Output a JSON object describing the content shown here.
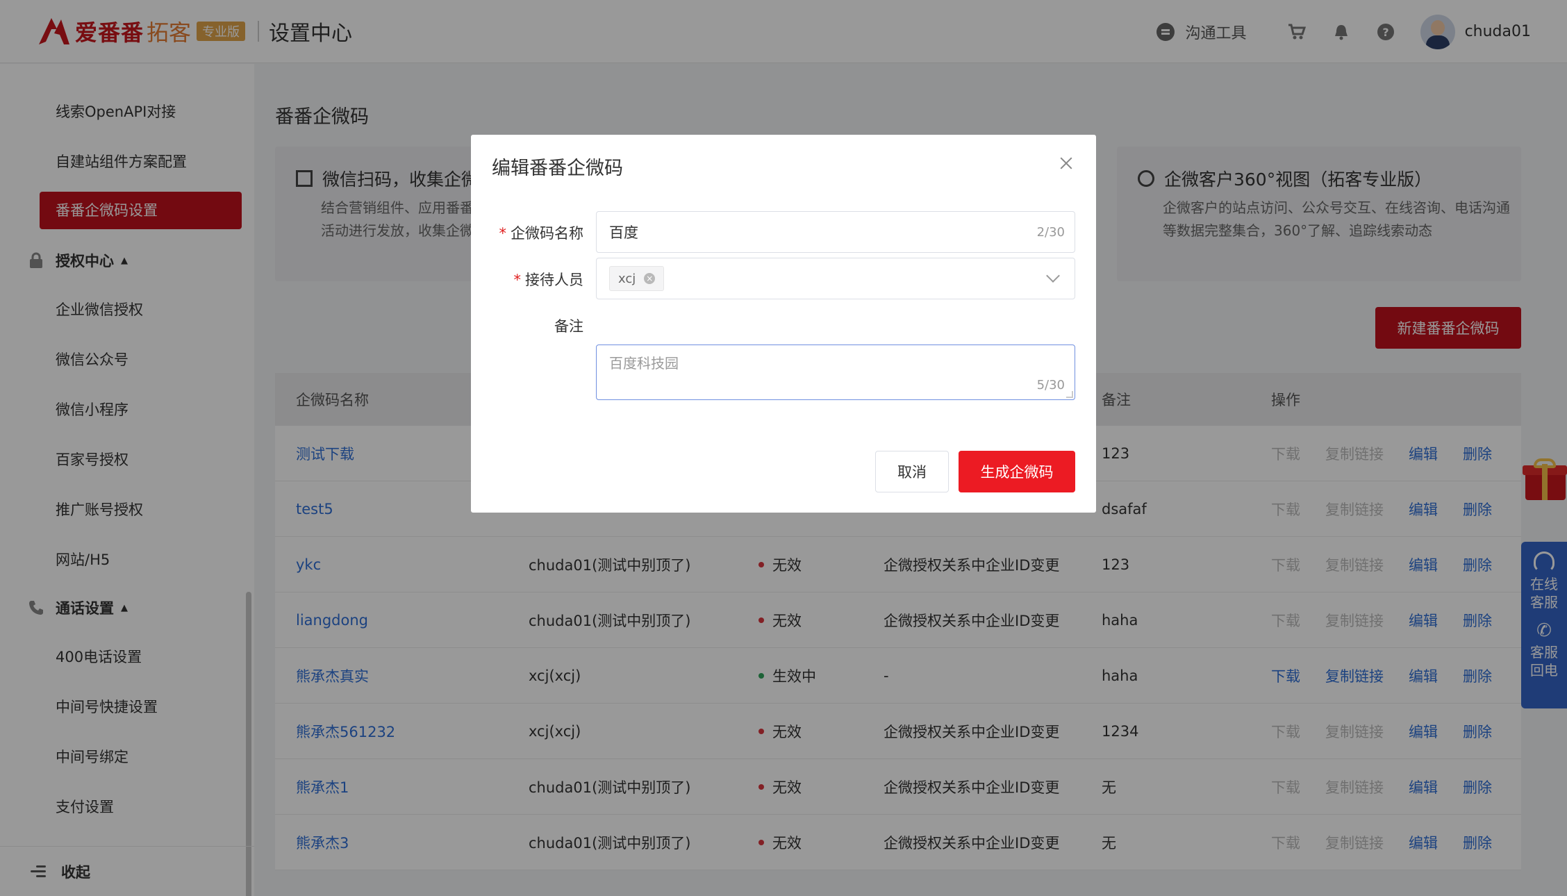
{
  "header": {
    "brand": "爱番番",
    "brand_sub": "拓客",
    "badge": "专业版",
    "page_title": "设置中心",
    "comm_tool": "沟通工具",
    "user_name": "chuda01"
  },
  "sidebar": {
    "items_top": [
      "线索OpenAPI对接",
      "自建站组件方案配置"
    ],
    "active_item": "番番企微码设置",
    "group_auth": "授权中心",
    "auth_items": [
      "企业微信授权",
      "微信公众号",
      "微信小程序",
      "百家号授权",
      "推广账号授权",
      "网站/H5"
    ],
    "group_call": "通话设置",
    "call_items": [
      "400电话设置",
      "中间号快捷设置",
      "中间号绑定",
      "支付设置"
    ],
    "collapse": "收起"
  },
  "main": {
    "title": "番番企微码",
    "card1": {
      "head": "微信扫码，收集企微",
      "desc": "结合营销组件、应用番番\n活动进行发放，收集企微"
    },
    "card2": {
      "head": "企微客户360°视图（拓客专业版）",
      "desc": "企微客户的站点访问、公众号交互、在线咨询、电话沟通等数据完整集合，360°了解、追踪线索动态"
    },
    "new_button": "新建番番企微码"
  },
  "table": {
    "headers": {
      "name": "企微码名称",
      "remark": "备注",
      "ops": "操作"
    },
    "ops_labels": {
      "download": "下载",
      "copy": "复制链接",
      "edit": "编辑",
      "delete": "删除"
    },
    "rows": [
      {
        "name": "测试下载",
        "staff": "",
        "status": "",
        "reason": "",
        "remark": "123",
        "active": false
      },
      {
        "name": "test5",
        "staff": "",
        "status": "",
        "reason": "",
        "remark": "dsafaf",
        "active": false
      },
      {
        "name": "ykc",
        "staff": "chuda01(测试中别顶了)",
        "status": "无效",
        "reason": "企微授权关系中企业ID变更",
        "remark": "123",
        "active": false
      },
      {
        "name": "liangdong",
        "staff": "chuda01(测试中别顶了)",
        "status": "无效",
        "reason": "企微授权关系中企业ID变更",
        "remark": "haha",
        "active": false
      },
      {
        "name": "熊承杰真实",
        "staff": "xcj(xcj)",
        "status": "生效中",
        "reason": "-",
        "remark": "haha",
        "active": true
      },
      {
        "name": "熊承杰561232",
        "staff": "xcj(xcj)",
        "status": "无效",
        "reason": "企微授权关系中企业ID变更",
        "remark": "1234",
        "active": false
      },
      {
        "name": "熊承杰1",
        "staff": "chuda01(测试中别顶了)",
        "status": "无效",
        "reason": "企微授权关系中企业ID变更",
        "remark": "无",
        "active": false
      },
      {
        "name": "熊承杰3",
        "staff": "chuda01(测试中别顶了)",
        "status": "无效",
        "reason": "企微授权关系中企业ID变更",
        "remark": "无",
        "active": false
      }
    ]
  },
  "modal": {
    "title": "编辑番番企微码",
    "field_name_label": "企微码名称",
    "field_name_value": "百度",
    "field_name_count": "2/30",
    "field_staff_label": "接待人员",
    "field_staff_tag": "xcj",
    "field_remark_label": "备注",
    "field_remark_value": "百度科技园",
    "field_remark_count": "5/30",
    "cancel": "取消",
    "confirm": "生成企微码"
  },
  "float": {
    "online_service": "在线客服",
    "callback": "客服回电"
  },
  "colors": {
    "brand_red": "#c0121d",
    "confirm_red": "#ec1b23",
    "link_blue": "#2f6fd6",
    "float_blue": "#3565c6",
    "status_valid": "#2fa35a",
    "status_invalid": "#d9363e"
  }
}
